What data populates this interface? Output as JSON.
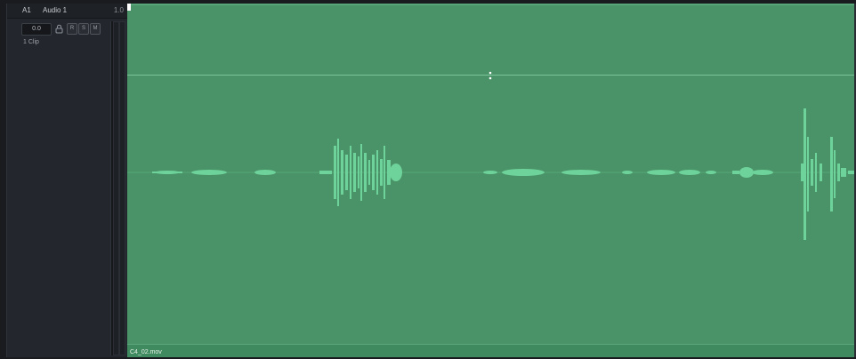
{
  "track": {
    "id": "A1",
    "name": "Audio 1",
    "level": "1.0",
    "volume": "0.0",
    "clip_count": "1 Clip",
    "buttons": {
      "record": "R",
      "solo": "S",
      "mute": "M"
    }
  },
  "clip": {
    "filename": "C4_02.mov"
  },
  "colors": {
    "clip_fill": "#4a9368",
    "waveform": "#6ed39a",
    "header_bg": "#23262c"
  }
}
